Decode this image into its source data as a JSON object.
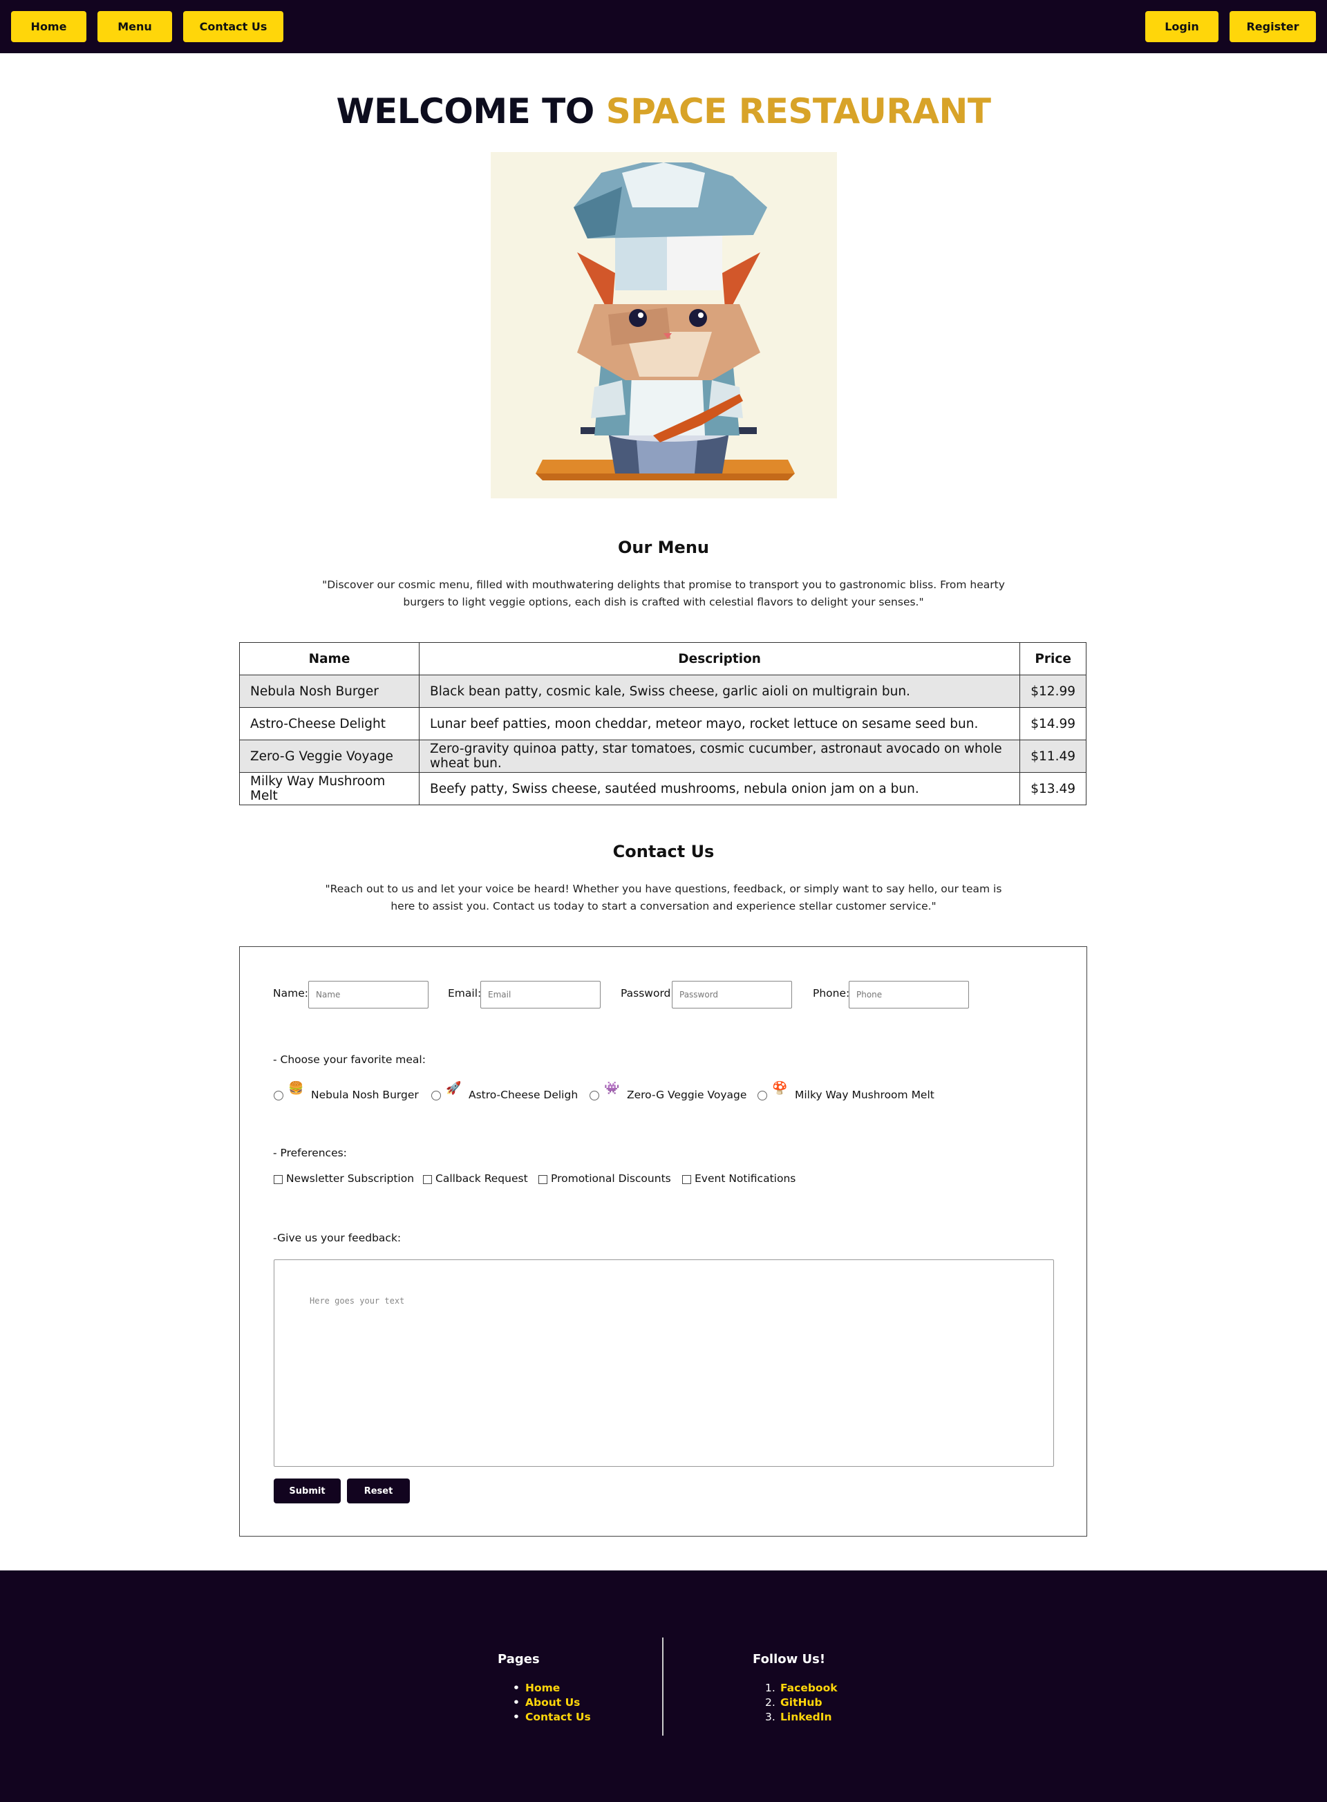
{
  "nav": {
    "home": "Home",
    "menu": "Menu",
    "contact": "Contact Us",
    "login": "Login",
    "register": "Register"
  },
  "hero": {
    "title_prefix": "WELCOME TO ",
    "title_accent": "SPACE RESTAURANT"
  },
  "menu_section": {
    "title": "Our Menu",
    "intro": "\"Discover our cosmic menu, filled with mouthwatering delights that promise to transport you to gastronomic bliss. From hearty burgers to light veggie options, each dish is crafted with celestial flavors to delight your senses.\"",
    "headers": [
      "Name",
      "Description",
      "Price"
    ],
    "rows": [
      {
        "name": "Nebula Nosh Burger",
        "description": "Black bean patty, cosmic kale, Swiss cheese, garlic aioli on multigrain bun.",
        "price": "$12.99"
      },
      {
        "name": "Astro-Cheese Delight",
        "description": "Lunar beef patties, moon cheddar, meteor mayo, rocket lettuce on sesame seed bun.",
        "price": "$14.99"
      },
      {
        "name": "Zero-G Veggie Voyage",
        "description": "Zero-gravity quinoa patty, star tomatoes, cosmic cucumber, astronaut avocado on whole wheat bun.",
        "price": "$11.49"
      },
      {
        "name": "Milky Way Mushroom Melt",
        "description": "Beefy patty, Swiss cheese, sautéed mushrooms, nebula onion jam on a bun.",
        "price": "$13.49"
      }
    ]
  },
  "contact_section": {
    "title": "Contact Us",
    "intro": "\"Reach out to us and let your voice be heard! Whether you have questions, feedback, or simply want to say hello, our team is here to assist you. Contact us today to start a conversation and experience stellar customer service.\""
  },
  "form": {
    "name_label": "Name:",
    "name_placeholder": "Name",
    "email_label": "Email:",
    "email_placeholder": "Email",
    "password_label": "Password:",
    "password_placeholder": "Password",
    "phone_label": "Phone:",
    "phone_placeholder": "Phone",
    "meal_label": "- Choose your favorite meal:",
    "meals": [
      "Nebula Nosh Burger",
      "Astro-Cheese Deligh",
      "Zero-G Veggie Voyage",
      "Milky Way Mushroom Melt"
    ],
    "prefs_label": "- Preferences:",
    "prefs": [
      "Newsletter Subscription",
      "Callback Request",
      "Promotional Discounts",
      "Event Notifications"
    ],
    "feedback_label": "-Give us your feedback:",
    "feedback_placeholder": "Here goes your text",
    "submit": "Submit",
    "reset": "Reset"
  },
  "footer": {
    "pages_title": "Pages",
    "pages": [
      "Home",
      "About Us",
      "Contact Us"
    ],
    "follow_title": "Follow Us!",
    "social": [
      "Facebook",
      "GitHub",
      "LinkedIn"
    ]
  },
  "colors": {
    "nav_bg": "#12041f",
    "accent_yellow": "#ffd60a",
    "title_gold": "#d8a328"
  }
}
